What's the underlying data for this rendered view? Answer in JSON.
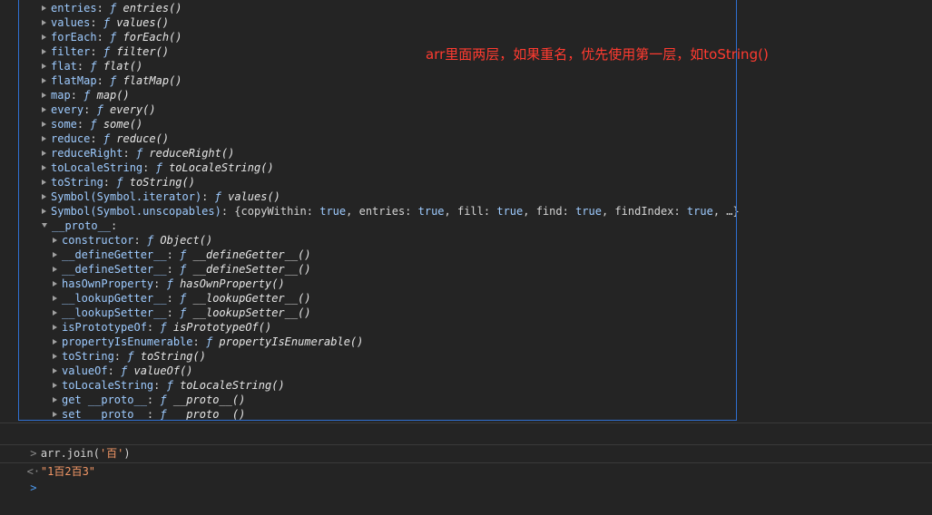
{
  "window_title": "",
  "tree": {
    "top_items": [
      {
        "key": "entries",
        "fmark": "ƒ",
        "value": "entries()"
      },
      {
        "key": "values",
        "fmark": "ƒ",
        "value": "values()"
      },
      {
        "key": "forEach",
        "fmark": "ƒ",
        "value": "forEach()"
      },
      {
        "key": "filter",
        "fmark": "ƒ",
        "value": "filter()"
      },
      {
        "key": "flat",
        "fmark": "ƒ",
        "value": "flat()"
      },
      {
        "key": "flatMap",
        "fmark": "ƒ",
        "value": "flatMap()"
      },
      {
        "key": "map",
        "fmark": "ƒ",
        "value": "map()"
      },
      {
        "key": "every",
        "fmark": "ƒ",
        "value": "every()"
      },
      {
        "key": "some",
        "fmark": "ƒ",
        "value": "some()"
      },
      {
        "key": "reduce",
        "fmark": "ƒ",
        "value": "reduce()"
      },
      {
        "key": "reduceRight",
        "fmark": "ƒ",
        "value": "reduceRight()"
      },
      {
        "key": "toLocaleString",
        "fmark": "ƒ",
        "value": "toLocaleString()"
      },
      {
        "key": "toString",
        "fmark": "ƒ",
        "value": "toString()"
      },
      {
        "key": "Symbol(Symbol.iterator)",
        "fmark": "ƒ",
        "value": "values()"
      }
    ],
    "unscopables": {
      "key": "Symbol(Symbol.unscopables)",
      "open": "{",
      "entries": [
        {
          "k": "copyWithin",
          "v": "true"
        },
        {
          "k": "entries",
          "v": "true"
        },
        {
          "k": "fill",
          "v": "true"
        },
        {
          "k": "find",
          "v": "true"
        },
        {
          "k": "findIndex",
          "v": "true"
        }
      ],
      "ellipsis": "…}"
    },
    "proto_key": "__proto__",
    "proto_items": [
      {
        "key": "constructor",
        "fmark": "ƒ",
        "value": "Object()"
      },
      {
        "key": "__defineGetter__",
        "fmark": "ƒ",
        "value": "__defineGetter__()"
      },
      {
        "key": "__defineSetter__",
        "fmark": "ƒ",
        "value": "__defineSetter__()"
      },
      {
        "key": "hasOwnProperty",
        "fmark": "ƒ",
        "value": "hasOwnProperty()"
      },
      {
        "key": "__lookupGetter__",
        "fmark": "ƒ",
        "value": "__lookupGetter__()"
      },
      {
        "key": "__lookupSetter__",
        "fmark": "ƒ",
        "value": "__lookupSetter__()"
      },
      {
        "key": "isPrototypeOf",
        "fmark": "ƒ",
        "value": "isPrototypeOf()"
      },
      {
        "key": "propertyIsEnumerable",
        "fmark": "ƒ",
        "value": "propertyIsEnumerable()"
      },
      {
        "key": "toString",
        "fmark": "ƒ",
        "value": "toString()"
      },
      {
        "key": "valueOf",
        "fmark": "ƒ",
        "value": "valueOf()"
      },
      {
        "key": "toLocaleString",
        "fmark": "ƒ",
        "value": "toLocaleString()"
      },
      {
        "key": "get __proto__",
        "fmark": "ƒ",
        "value": "__proto__()"
      },
      {
        "key": "set __proto__",
        "fmark": "ƒ",
        "value": "__proto__()"
      }
    ]
  },
  "annotation": "arr里面两层，如果重名，优先使用第一层，如toString()",
  "command": {
    "prompt": ">",
    "code_prefix": "arr.join(",
    "code_arg": "'百'",
    "code_suffix": ")"
  },
  "result": {
    "prompt": "<·",
    "value": "\"1百2百3\""
  },
  "input_prompt": ">",
  "colors": {
    "background": "#242424",
    "highlight_border": "#2f6fd1",
    "annotation": "#ff3b30",
    "key": "#9ecbff",
    "string": "#f29766"
  }
}
